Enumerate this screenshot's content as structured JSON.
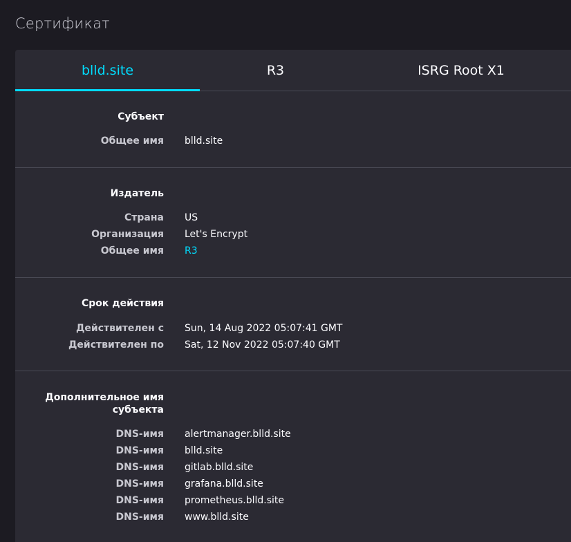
{
  "page": {
    "title": "Сертификат"
  },
  "tabs": [
    {
      "label": "blld.site",
      "active": true
    },
    {
      "label": "R3",
      "active": false
    },
    {
      "label": "ISRG Root X1",
      "active": false
    }
  ],
  "subject": {
    "heading": "Субъект",
    "common_name_label": "Общее имя",
    "common_name": "blld.site"
  },
  "issuer": {
    "heading": "Издатель",
    "country_label": "Страна",
    "country": "US",
    "organization_label": "Организация",
    "organization": "Let's Encrypt",
    "common_name_label": "Общее имя",
    "common_name": "R3"
  },
  "validity": {
    "heading": "Срок действия",
    "not_before_label": "Действителен с",
    "not_before": "Sun, 14 Aug 2022 05:07:41 GMT",
    "not_after_label": "Действителен по",
    "not_after": "Sat, 12 Nov 2022 05:07:40 GMT"
  },
  "san": {
    "heading_line1": "Дополнительное имя",
    "heading_line2": "субъекта",
    "dns_label": "DNS-имя",
    "names": [
      "alertmanager.blld.site",
      "blld.site",
      "gitlab.blld.site",
      "grafana.blld.site",
      "prometheus.blld.site",
      "www.blld.site"
    ]
  },
  "colors": {
    "accent": "#00ddff",
    "background": "#1c1b22",
    "card": "#2b2a33",
    "divider": "#4a4a55"
  }
}
